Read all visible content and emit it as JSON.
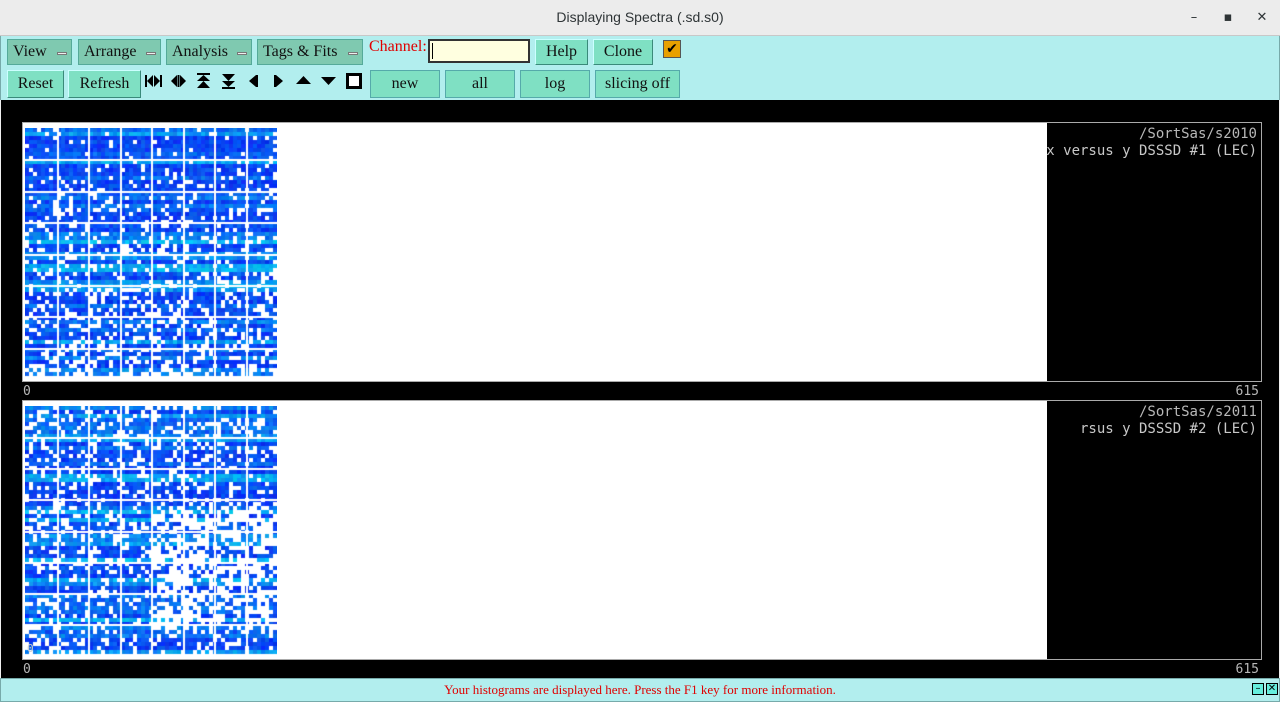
{
  "window": {
    "title": "Displaying Spectra (.sd.s0)",
    "minimize": "–",
    "maximize": "▪",
    "close": "✕"
  },
  "menus": [
    "View",
    "Arrange",
    "Analysis",
    "Tags & Fits"
  ],
  "channel": {
    "label": "Channel:",
    "value": ""
  },
  "buttons": {
    "help": "Help",
    "clone": "Clone",
    "reset": "Reset",
    "refresh": "Refresh",
    "new": "new",
    "all": "all",
    "log": "log",
    "slicing": "slicing off"
  },
  "checkbox": {
    "checked": true,
    "glyph": "✔"
  },
  "nav_icons": [
    "first-page-icon",
    "expand-horizontal-icon",
    "expand-up-icon",
    "expand-down-icon",
    "prev-icon",
    "next-icon",
    "up-icon",
    "down-icon",
    "stop-icon"
  ],
  "spectra": [
    {
      "path": "/SortSas/s2010",
      "description": "x versus y DSSSD #1 (LEC)",
      "axis_min": "0",
      "axis_max": "615"
    },
    {
      "path": "/SortSas/s2011",
      "description": "rsus y DSSSD #2 (LEC)",
      "axis_min": "0",
      "axis_max": "615",
      "corner_label": "0"
    }
  ],
  "status": {
    "message": "Your histograms are displayed here. Press the F1 key for more information."
  },
  "colors": {
    "toolbar_bg": "#b2eeee",
    "button_bg": "#7fe0c3",
    "status_text": "#e00000",
    "checkbox": "#e8a000",
    "heatmap_low": "#1030f0",
    "heatmap_high": "#20f0a0"
  }
}
